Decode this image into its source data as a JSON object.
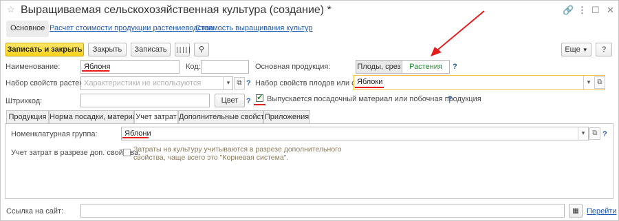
{
  "window": {
    "title": "Выращиваемая сельскохозяйственная культура (создание) *"
  },
  "nav": {
    "main_tab": "Основное",
    "link1": "Расчет стоимости продукции растениеводства",
    "link2": "Стоимость выращивания культур"
  },
  "toolbar": {
    "save_close": "Записать и закрыть",
    "close": "Закрыть",
    "save": "Записать",
    "more": "Еще",
    "help": "?"
  },
  "form": {
    "name_label": "Наименование:",
    "name_value": "Яблоня",
    "code_label": "Код:",
    "code_value": "",
    "props_label": "Набор свойств растения:",
    "props_placeholder": "Характеристики не используются",
    "barcode_label": "Штрихкод:",
    "color_button": "Цвет",
    "main_product_label": "Основная продукция:",
    "seg_fruits": "Плоды, срез",
    "seg_plants": "Растения",
    "fruit_props_label": "Набор свойств плодов или среза:",
    "fruit_props_value": "Яблоки",
    "planting_checkbox_label": "Выпускается посадочный материал или побочная продукция",
    "planting_checked": true
  },
  "tabs": [
    "Продукция",
    "Норма посадки, материал",
    "Учет затрат",
    "Дополнительные свойства",
    "Приложения"
  ],
  "costs": {
    "nomenclature_label": "Номенклатурная группа:",
    "nomenclature_value": "Яблони",
    "addprops_label": "Учет затрат в разрезе доп. свойства:",
    "addprops_note_line1": "Затраты на культуру учитываются в разрезе дополнительного",
    "addprops_note_line2": "свойства, чаще всего это \"Корневая система\"."
  },
  "footer": {
    "site_label": "Ссылка на сайт:",
    "site_value": "",
    "go_link": "Перейти"
  },
  "colors": {
    "accent_red": "#e81b1b",
    "primary_yellow": "#f5d21c",
    "link_blue": "#1e5bb4",
    "active_green": "#1a8a2a"
  },
  "icons": [
    "star-icon",
    "link-icon",
    "more-icon",
    "maximize-icon",
    "close-icon",
    "barcode-icon",
    "pin-icon",
    "dropdown-icon",
    "open-icon",
    "qr-icon",
    "red-arrow-annotation"
  ]
}
